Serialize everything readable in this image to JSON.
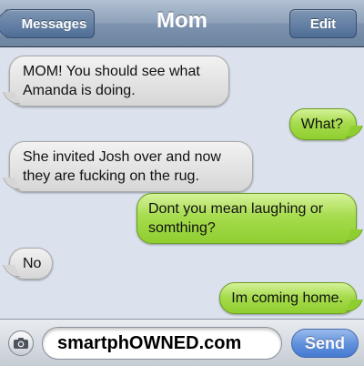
{
  "navbar": {
    "title": "Mom",
    "back_label": "Messages",
    "edit_label": "Edit"
  },
  "messages": [
    {
      "direction": "incoming",
      "text": "MOM! You should see what Amanda is doing."
    },
    {
      "direction": "outgoing",
      "text": "What?"
    },
    {
      "direction": "incoming",
      "text": "She invited Josh over and now they are fucking on the rug."
    },
    {
      "direction": "outgoing",
      "text": "Dont you mean laughing or somthing?"
    },
    {
      "direction": "incoming",
      "text": "No"
    },
    {
      "direction": "outgoing",
      "text": "Im coming home."
    }
  ],
  "composer": {
    "camera_icon": "camera-icon",
    "text_value": "smartphOWNED.com",
    "send_label": "Send"
  },
  "colors": {
    "navbar": "#8ea2ba",
    "incoming_bubble": "#e4e4e4",
    "outgoing_bubble": "#a7dc4e",
    "background": "#dbe2ed",
    "send_button": "#4f86dc"
  }
}
